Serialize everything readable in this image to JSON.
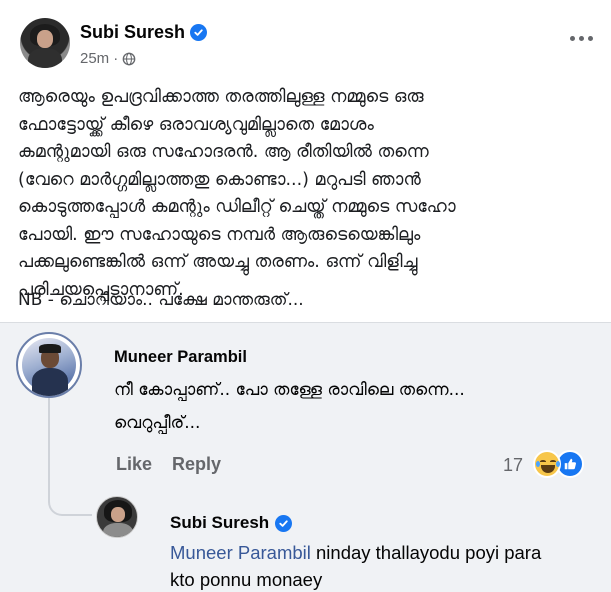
{
  "post": {
    "author": "Subi Suresh",
    "time": "25m",
    "time_separator": "·",
    "text": "ആരെയും ഉപദ്രവിക്കാത്ത തരത്തിലുള്ള നമ്മുടെ ഒരു\nഫോട്ടോയ്ക്ക് കീഴെ ഒരാവശ്യവുമില്ലാതെ മോശം\nകമന്റുമായി ഒരു സഹോദരൻ. ആ രീതിയിൽ തന്നെ\n(വേറെ മാർഗ്ഗമില്ലാത്തതു കൊണ്ടാ...) മറുപടി ഞാൻ\nകൊടുത്തപ്പോൾ കമന്റും ഡിലീറ്റ് ചെയ്ത് നമ്മുടെ സഹോ\nപോയി. ഈ സഹോയുടെ നമ്പർ ആരുടെയെങ്കിലും\nപക്കലുണ്ടെങ്കിൽ ഒന്ന് അയച്ചു തരണം. ഒന്ന് വിളിച്ചു\nപരിചയപ്പെടാനാണ്.",
    "nb_text": "NB - ചൊറിയാം.. പക്ഷേ മാന്തരുത്..."
  },
  "comment1": {
    "author": "Muneer Parambil",
    "text": "നീ കോപ്പാണ്.. പോ തള്ളേ രാവിലെ തന്നെ...\nവെറുപ്പീര്...",
    "like_label": "Like",
    "reply_label": "Reply",
    "reaction_count": "17"
  },
  "reply1": {
    "author": "Subi Suresh",
    "mention": "Muneer Parambil",
    "text": " ninday thallayodu poyi para kto ponnu monaey"
  },
  "icons": {
    "verified": "verified-badge-icon",
    "privacy": "globe-icon",
    "more": "more-options-icon",
    "reaction_haha": "haha-reaction-icon",
    "reaction_like": "like-reaction-icon"
  },
  "colors": {
    "facebook_blue": "#1877f2",
    "secondary_text": "#65676b",
    "mention": "#385898",
    "bubble": "#f0f2f5"
  }
}
